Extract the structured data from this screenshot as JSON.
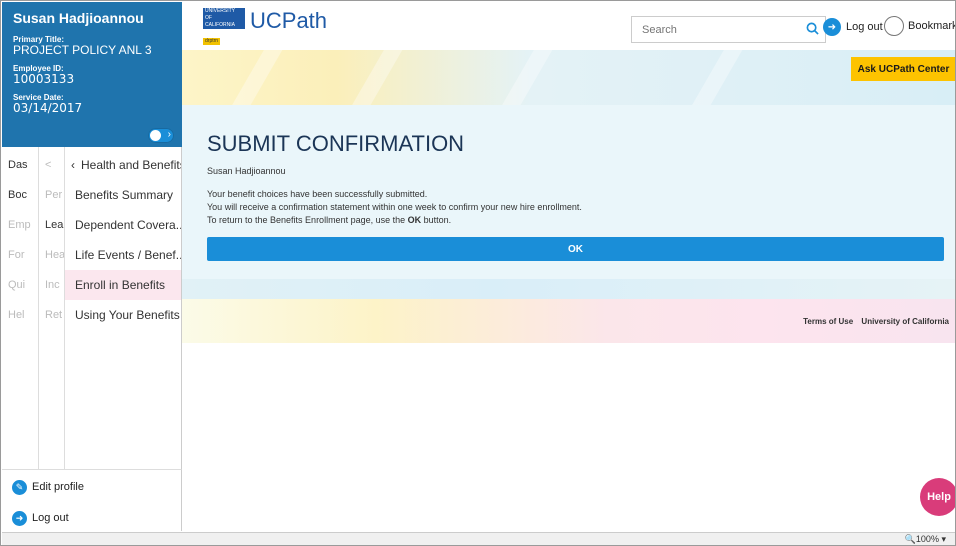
{
  "profile": {
    "name": "Susan Hadjioannou",
    "primary_title_label": "Primary Title:",
    "primary_title": "PROJECT POLICY ANL 3",
    "employee_id_label": "Employee ID:",
    "employee_id": "10003133",
    "service_date_label": "Service Date:",
    "service_date": "03/14/2017"
  },
  "nav": {
    "col_a": [
      "Das",
      "Boc",
      "Emp",
      "For",
      "Qui",
      "Hel"
    ],
    "col_b": [
      "Per",
      "Lea",
      "Hea",
      "Inc",
      "Ret"
    ],
    "col_b_back": "<",
    "col_c_header": "Health and Benefits",
    "col_c_items": [
      "Benefits Summary",
      "Dependent Covera...",
      "Life Events / Benef...",
      "Enroll in Benefits",
      "Using Your Benefits"
    ]
  },
  "bottom": {
    "edit_profile": "Edit profile",
    "logout": "Log out"
  },
  "header": {
    "logo_university": "UNIVERSITY",
    "logo_of": "OF",
    "logo_california": "CALIFORNIA",
    "logo_badge": "drptrn",
    "app_title": "UCPath",
    "search_placeholder": "Search",
    "logout": "Log out",
    "bookmark": "Bookmark"
  },
  "banner": {
    "ask_button": "Ask UCPath Center"
  },
  "content": {
    "title": "SUBMIT CONFIRMATION",
    "name": "Susan Hadjioannou",
    "msg1": "Your benefit choices have been successfully submitted.",
    "msg2": "You will receive a confirmation statement within one week to confirm your new hire enrollment.",
    "msg3_pre": "To return to the Benefits Enrollment page, use the ",
    "msg3_bold": "OK",
    "msg3_post": " button.",
    "ok_button": "OK"
  },
  "footer": {
    "terms": "Terms of Use",
    "university": "University of California"
  },
  "help": "Help",
  "statusbar": {
    "zoom": "100%"
  }
}
